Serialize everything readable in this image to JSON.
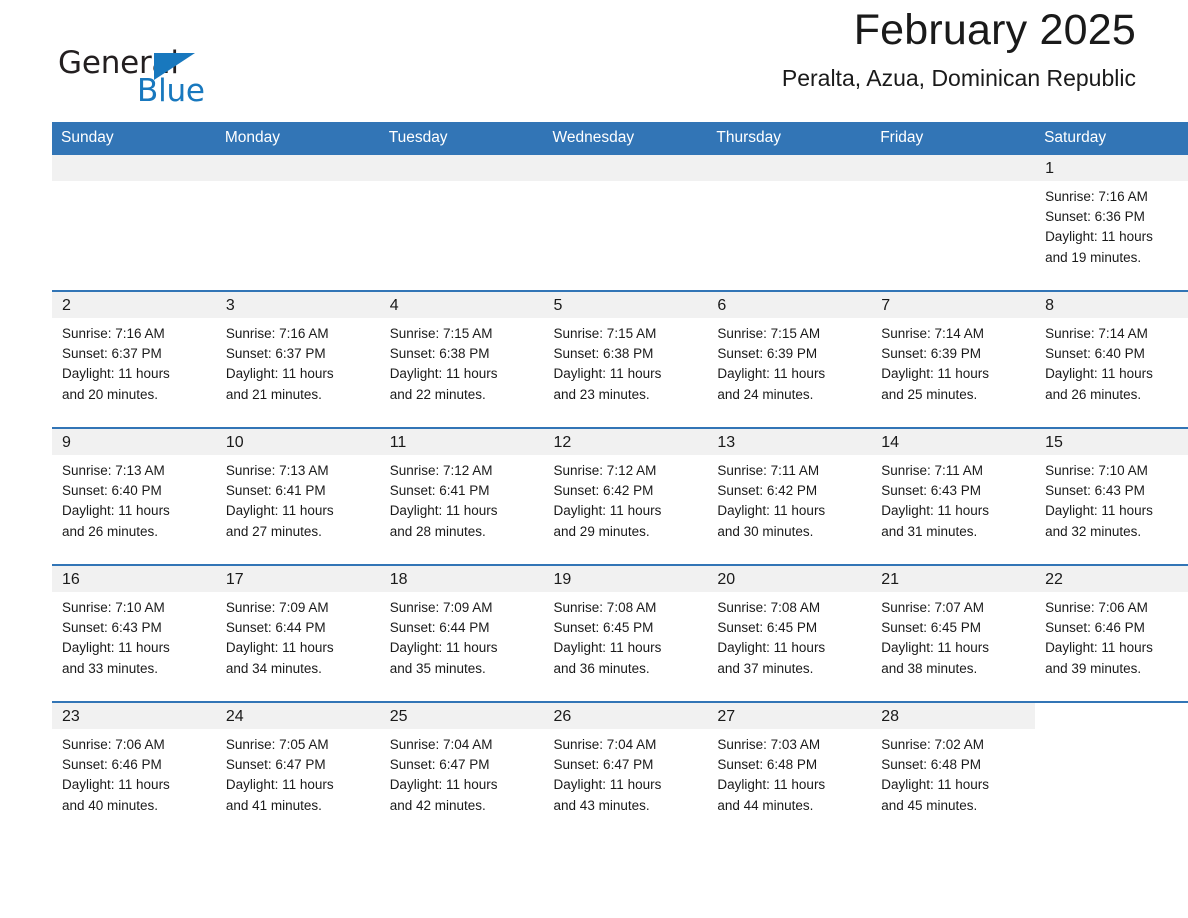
{
  "brand": {
    "name_part1": "General",
    "name_part2": "Blue",
    "accent_color": "#1878be",
    "triangle_icon": "triangle-icon"
  },
  "header": {
    "title": "February 2025",
    "subtitle": "Peralta, Azua, Dominican Republic"
  },
  "calendar": {
    "header_bg": "#3275b6",
    "daynum_bg": "#f1f1f1",
    "weekdays": [
      "Sunday",
      "Monday",
      "Tuesday",
      "Wednesday",
      "Thursday",
      "Friday",
      "Saturday"
    ],
    "weeks": [
      [
        {
          "day": "",
          "sunrise": "",
          "sunset": "",
          "daylight1": "",
          "daylight2": ""
        },
        {
          "day": "",
          "sunrise": "",
          "sunset": "",
          "daylight1": "",
          "daylight2": ""
        },
        {
          "day": "",
          "sunrise": "",
          "sunset": "",
          "daylight1": "",
          "daylight2": ""
        },
        {
          "day": "",
          "sunrise": "",
          "sunset": "",
          "daylight1": "",
          "daylight2": ""
        },
        {
          "day": "",
          "sunrise": "",
          "sunset": "",
          "daylight1": "",
          "daylight2": ""
        },
        {
          "day": "",
          "sunrise": "",
          "sunset": "",
          "daylight1": "",
          "daylight2": ""
        },
        {
          "day": "1",
          "sunrise": "Sunrise: 7:16 AM",
          "sunset": "Sunset: 6:36 PM",
          "daylight1": "Daylight: 11 hours",
          "daylight2": "and 19 minutes."
        }
      ],
      [
        {
          "day": "2",
          "sunrise": "Sunrise: 7:16 AM",
          "sunset": "Sunset: 6:37 PM",
          "daylight1": "Daylight: 11 hours",
          "daylight2": "and 20 minutes."
        },
        {
          "day": "3",
          "sunrise": "Sunrise: 7:16 AM",
          "sunset": "Sunset: 6:37 PM",
          "daylight1": "Daylight: 11 hours",
          "daylight2": "and 21 minutes."
        },
        {
          "day": "4",
          "sunrise": "Sunrise: 7:15 AM",
          "sunset": "Sunset: 6:38 PM",
          "daylight1": "Daylight: 11 hours",
          "daylight2": "and 22 minutes."
        },
        {
          "day": "5",
          "sunrise": "Sunrise: 7:15 AM",
          "sunset": "Sunset: 6:38 PM",
          "daylight1": "Daylight: 11 hours",
          "daylight2": "and 23 minutes."
        },
        {
          "day": "6",
          "sunrise": "Sunrise: 7:15 AM",
          "sunset": "Sunset: 6:39 PM",
          "daylight1": "Daylight: 11 hours",
          "daylight2": "and 24 minutes."
        },
        {
          "day": "7",
          "sunrise": "Sunrise: 7:14 AM",
          "sunset": "Sunset: 6:39 PM",
          "daylight1": "Daylight: 11 hours",
          "daylight2": "and 25 minutes."
        },
        {
          "day": "8",
          "sunrise": "Sunrise: 7:14 AM",
          "sunset": "Sunset: 6:40 PM",
          "daylight1": "Daylight: 11 hours",
          "daylight2": "and 26 minutes."
        }
      ],
      [
        {
          "day": "9",
          "sunrise": "Sunrise: 7:13 AM",
          "sunset": "Sunset: 6:40 PM",
          "daylight1": "Daylight: 11 hours",
          "daylight2": "and 26 minutes."
        },
        {
          "day": "10",
          "sunrise": "Sunrise: 7:13 AM",
          "sunset": "Sunset: 6:41 PM",
          "daylight1": "Daylight: 11 hours",
          "daylight2": "and 27 minutes."
        },
        {
          "day": "11",
          "sunrise": "Sunrise: 7:12 AM",
          "sunset": "Sunset: 6:41 PM",
          "daylight1": "Daylight: 11 hours",
          "daylight2": "and 28 minutes."
        },
        {
          "day": "12",
          "sunrise": "Sunrise: 7:12 AM",
          "sunset": "Sunset: 6:42 PM",
          "daylight1": "Daylight: 11 hours",
          "daylight2": "and 29 minutes."
        },
        {
          "day": "13",
          "sunrise": "Sunrise: 7:11 AM",
          "sunset": "Sunset: 6:42 PM",
          "daylight1": "Daylight: 11 hours",
          "daylight2": "and 30 minutes."
        },
        {
          "day": "14",
          "sunrise": "Sunrise: 7:11 AM",
          "sunset": "Sunset: 6:43 PM",
          "daylight1": "Daylight: 11 hours",
          "daylight2": "and 31 minutes."
        },
        {
          "day": "15",
          "sunrise": "Sunrise: 7:10 AM",
          "sunset": "Sunset: 6:43 PM",
          "daylight1": "Daylight: 11 hours",
          "daylight2": "and 32 minutes."
        }
      ],
      [
        {
          "day": "16",
          "sunrise": "Sunrise: 7:10 AM",
          "sunset": "Sunset: 6:43 PM",
          "daylight1": "Daylight: 11 hours",
          "daylight2": "and 33 minutes."
        },
        {
          "day": "17",
          "sunrise": "Sunrise: 7:09 AM",
          "sunset": "Sunset: 6:44 PM",
          "daylight1": "Daylight: 11 hours",
          "daylight2": "and 34 minutes."
        },
        {
          "day": "18",
          "sunrise": "Sunrise: 7:09 AM",
          "sunset": "Sunset: 6:44 PM",
          "daylight1": "Daylight: 11 hours",
          "daylight2": "and 35 minutes."
        },
        {
          "day": "19",
          "sunrise": "Sunrise: 7:08 AM",
          "sunset": "Sunset: 6:45 PM",
          "daylight1": "Daylight: 11 hours",
          "daylight2": "and 36 minutes."
        },
        {
          "day": "20",
          "sunrise": "Sunrise: 7:08 AM",
          "sunset": "Sunset: 6:45 PM",
          "daylight1": "Daylight: 11 hours",
          "daylight2": "and 37 minutes."
        },
        {
          "day": "21",
          "sunrise": "Sunrise: 7:07 AM",
          "sunset": "Sunset: 6:45 PM",
          "daylight1": "Daylight: 11 hours",
          "daylight2": "and 38 minutes."
        },
        {
          "day": "22",
          "sunrise": "Sunrise: 7:06 AM",
          "sunset": "Sunset: 6:46 PM",
          "daylight1": "Daylight: 11 hours",
          "daylight2": "and 39 minutes."
        }
      ],
      [
        {
          "day": "23",
          "sunrise": "Sunrise: 7:06 AM",
          "sunset": "Sunset: 6:46 PM",
          "daylight1": "Daylight: 11 hours",
          "daylight2": "and 40 minutes."
        },
        {
          "day": "24",
          "sunrise": "Sunrise: 7:05 AM",
          "sunset": "Sunset: 6:47 PM",
          "daylight1": "Daylight: 11 hours",
          "daylight2": "and 41 minutes."
        },
        {
          "day": "25",
          "sunrise": "Sunrise: 7:04 AM",
          "sunset": "Sunset: 6:47 PM",
          "daylight1": "Daylight: 11 hours",
          "daylight2": "and 42 minutes."
        },
        {
          "day": "26",
          "sunrise": "Sunrise: 7:04 AM",
          "sunset": "Sunset: 6:47 PM",
          "daylight1": "Daylight: 11 hours",
          "daylight2": "and 43 minutes."
        },
        {
          "day": "27",
          "sunrise": "Sunrise: 7:03 AM",
          "sunset": "Sunset: 6:48 PM",
          "daylight1": "Daylight: 11 hours",
          "daylight2": "and 44 minutes."
        },
        {
          "day": "28",
          "sunrise": "Sunrise: 7:02 AM",
          "sunset": "Sunset: 6:48 PM",
          "daylight1": "Daylight: 11 hours",
          "daylight2": "and 45 minutes."
        },
        {
          "day": "",
          "sunrise": "",
          "sunset": "",
          "daylight1": "",
          "daylight2": ""
        }
      ]
    ]
  }
}
